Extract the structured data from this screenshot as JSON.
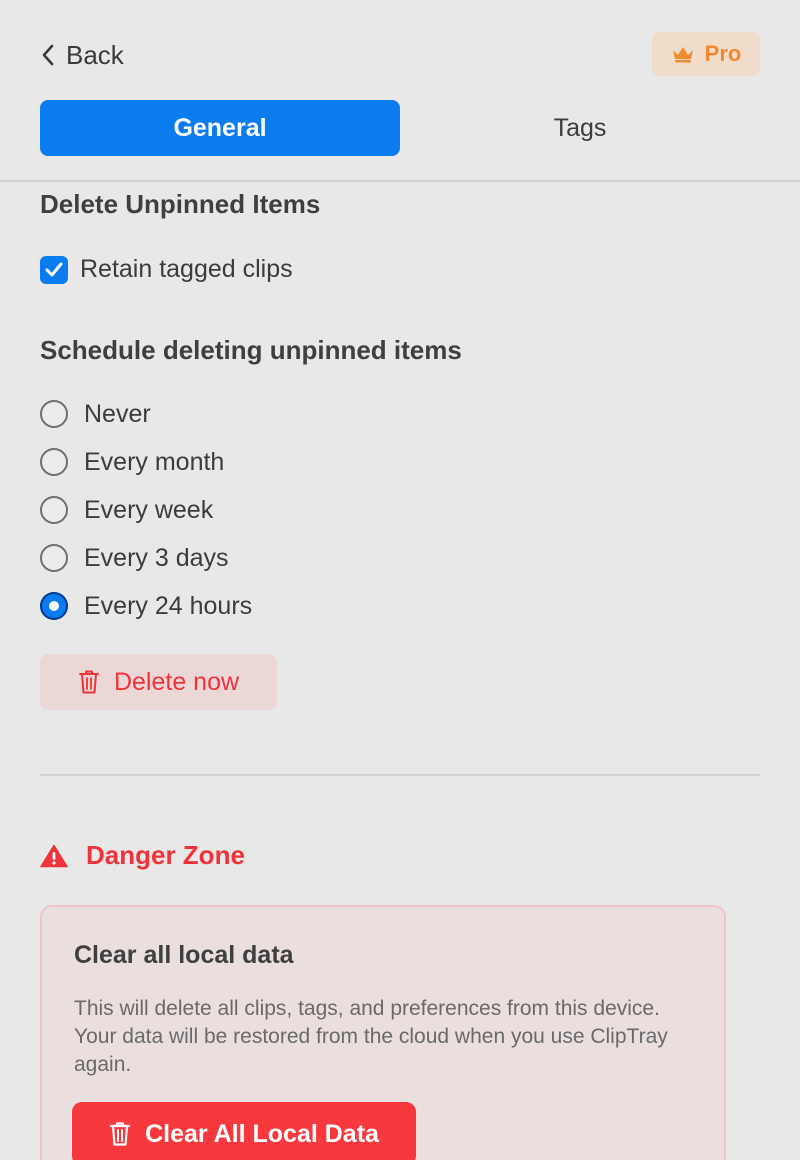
{
  "header": {
    "back_label": "Back",
    "back_icon": "chevron-left-icon",
    "pro_label": "Pro",
    "pro_icon": "crown-icon"
  },
  "tabs": [
    {
      "label": "General",
      "active": true
    },
    {
      "label": "Tags",
      "active": false
    }
  ],
  "delete_section": {
    "title": "Delete Unpinned Items",
    "retain_label": "Retain tagged clips",
    "retain_checked": true
  },
  "schedule_section": {
    "title": "Schedule deleting unpinned items",
    "options": [
      {
        "label": "Never",
        "selected": false
      },
      {
        "label": "Every month",
        "selected": false
      },
      {
        "label": "Every week",
        "selected": false
      },
      {
        "label": "Every 3 days",
        "selected": false
      },
      {
        "label": "Every 24 hours",
        "selected": true
      }
    ],
    "delete_now_label": "Delete now"
  },
  "danger_zone": {
    "title": "Danger Zone",
    "box_title": "Clear all local data",
    "box_description": "This will delete all clips, tags, and preferences from this device. Your data will be restored from the cloud when you use ClipTray again.",
    "clear_button_label": "Clear All Local Data"
  },
  "colors": {
    "accent": "#0a7cf0",
    "danger": "#f0323a",
    "pro": "#ef8a2e",
    "background": "#e8e8e8"
  }
}
